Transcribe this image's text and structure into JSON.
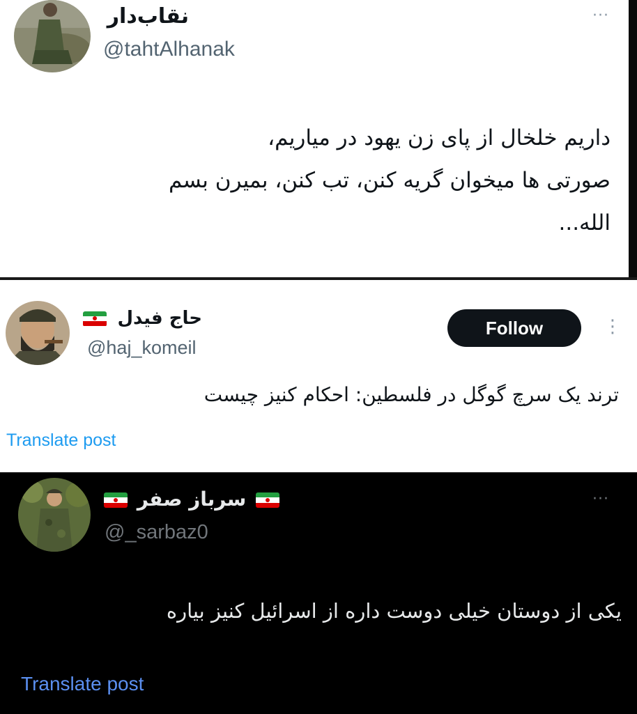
{
  "posts": [
    {
      "display_name": "نقاب‌دار",
      "handle": "@tahtAlhanak",
      "more_glyph": "···",
      "text_lines": [
        "داریم خلخال از پای زن یهود در میاریم،",
        "صورتی ها میخوان گریه کنن، تب کنن، بمیرن بسم",
        "الله..."
      ]
    },
    {
      "display_name": "حاج فیدل",
      "handle": "@haj_komeil",
      "follow_label": "Follow",
      "more_glyph": "⋮",
      "text_lines": [
        "ترند یک سرچ گوگل در فلسطین: احکام کنیز چیست"
      ],
      "translate_label": "Translate post"
    },
    {
      "display_name": "سرباز صفر",
      "handle": "@_sarbaz0",
      "more_glyph": "···",
      "text_lines": [
        "یکی از دوستان خیلی دوست داره از اسرائیل کنیز بیاره"
      ],
      "translate_label": "Translate post"
    }
  ],
  "colors": {
    "follow_bg": "#0f1419",
    "link": "#1d9bf0",
    "muted_light": "#536471",
    "muted_dark": "#71767b",
    "flag_green": "#239f40",
    "flag_red": "#da0000"
  }
}
